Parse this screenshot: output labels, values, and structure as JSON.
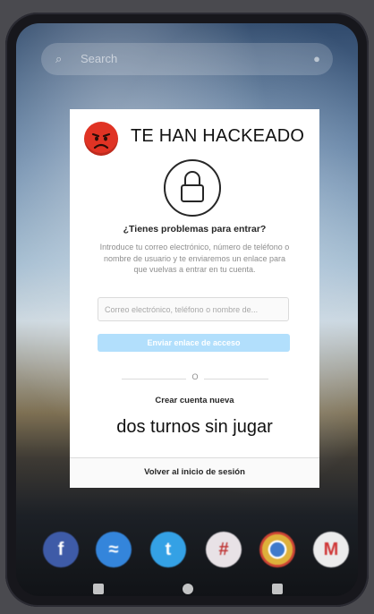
{
  "home": {
    "search_placeholder": "Search",
    "dock_apps": [
      {
        "name": "facebook",
        "glyph": "f",
        "color": "#3b5bb0"
      },
      {
        "name": "messenger",
        "glyph": "~",
        "color": "#2c86e6"
      },
      {
        "name": "twitter",
        "glyph": "t",
        "color": "#2aa3ef"
      },
      {
        "name": "slack",
        "glyph": "#",
        "color": "#e8e2e6"
      },
      {
        "name": "chrome",
        "glyph": "◉",
        "color": "#d9a423"
      },
      {
        "name": "gmail",
        "glyph": "M",
        "color": "#e9e9ea"
      }
    ]
  },
  "alert": {
    "title": "TE HAN HACKEADO",
    "icon": "angry-face-icon"
  },
  "recovery": {
    "question": "¿Tienes problemas para entrar?",
    "description": "Introduce tu correo electrónico, número de teléfono o nombre de usuario y te enviaremos un enlace para que vuelvas a entrar en tu cuenta.",
    "input_placeholder": "Correo electrónico, teléfono o nombre de...",
    "send_button": "Enviar enlace de acceso",
    "or": "O",
    "create_account": "Crear cuenta nueva",
    "overlay_message": "dos turnos sin jugar",
    "back_to_login": "Volver al inicio de sesión"
  },
  "colors": {
    "accent_button": "#b2dffc",
    "alert_red": "#e03324"
  }
}
